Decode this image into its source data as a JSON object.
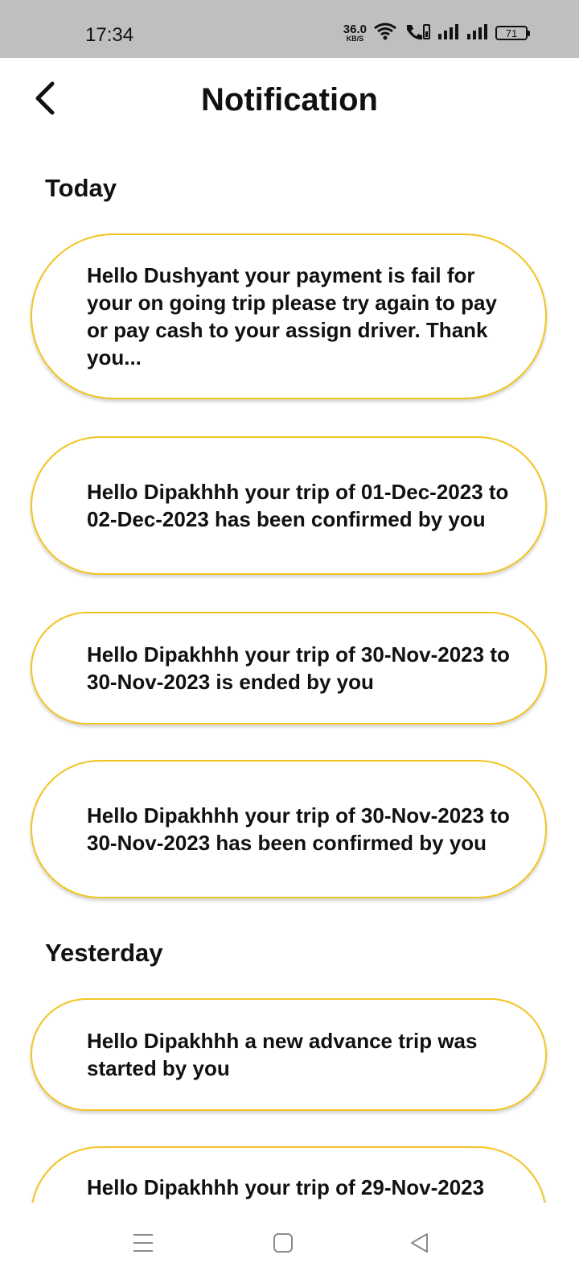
{
  "status_bar": {
    "time": "17:34",
    "net_speed_value": "36.0",
    "net_speed_unit": "KB/S",
    "battery": "71"
  },
  "header": {
    "title": "Notification",
    "back_icon": "chevron-left-icon"
  },
  "sections": [
    {
      "heading": "Today",
      "notifications": [
        "Hello Dushyant your payment is fail for your on going trip please try again to pay or pay cash to your assign driver. Thank you...",
        "Hello Dipakhhh your trip of 01-Dec-2023 to 02-Dec-2023 has been confirmed by you",
        "Hello Dipakhhh your trip of 30-Nov-2023 to 30-Nov-2023 is ended by you",
        "Hello Dipakhhh your trip of 30-Nov-2023 to 30-Nov-2023 has been confirmed by you"
      ]
    },
    {
      "heading": "Yesterday",
      "notifications": [
        "Hello Dipakhhh a new advance trip was started by you",
        "Hello Dipakhhh your trip of 29-Nov-2023"
      ]
    }
  ],
  "colors": {
    "card_border": "#f2c523",
    "status_bar_bg": "#bfbfbf",
    "text": "#111111"
  },
  "nav_bar": {
    "icons": [
      "menu-icon",
      "home-square-icon",
      "back-triangle-icon"
    ]
  }
}
